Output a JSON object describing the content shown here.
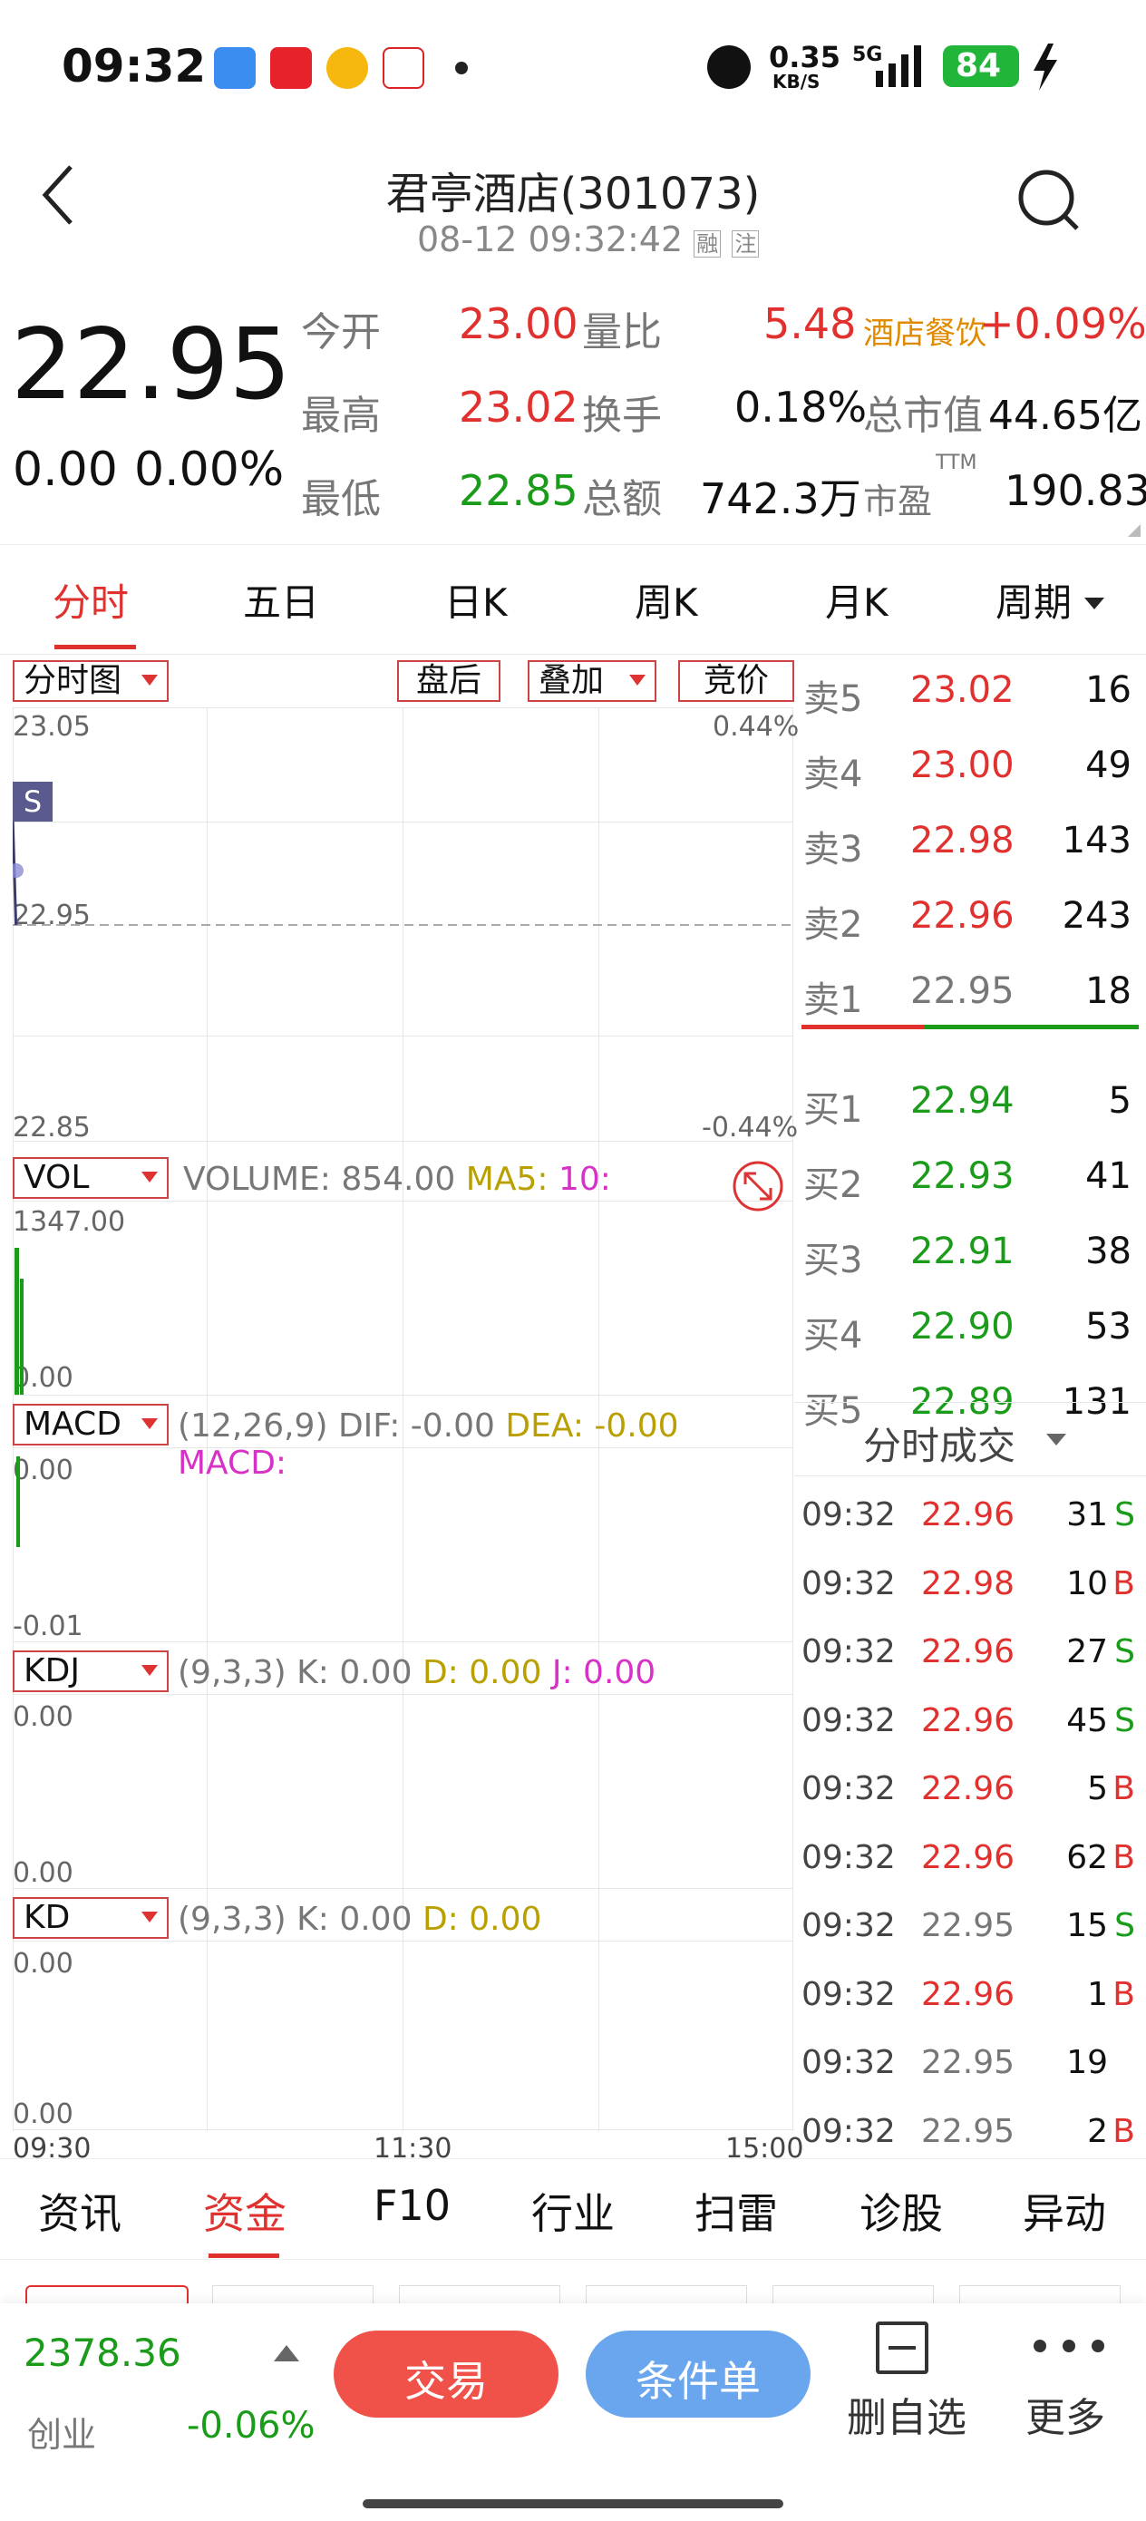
{
  "status_bar": {
    "time": "09:32",
    "net_speed": "0.35",
    "net_unit": "KB/S",
    "signal": "5G",
    "battery": "84"
  },
  "header": {
    "title": "君亭酒店(301073)",
    "subtitle": "08-12 09:32:42",
    "badge1": "融",
    "badge2": "注"
  },
  "quote": {
    "price": "22.95",
    "change": "0.00",
    "change_pct": "0.00%",
    "rows": [
      {
        "l1": "今开",
        "v1": "23.00",
        "l2": "量比",
        "v2": "5.48",
        "l3": "酒店餐饮",
        "v3": "+0.09%"
      },
      {
        "l1": "最高",
        "v1": "23.02",
        "l2": "换手",
        "v2": "0.18%",
        "l3": "总市值",
        "v3": "44.65亿"
      },
      {
        "l1": "最低",
        "v1": "22.85",
        "l2": "总额",
        "v2": "742.3万",
        "l3": "市盈",
        "l3sup": "TTM",
        "v3": "190.83"
      }
    ]
  },
  "tabs": [
    "分时",
    "五日",
    "日K",
    "周K",
    "月K",
    "周期"
  ],
  "chart_controls": {
    "timeshare": "分时图",
    "after": "盘后",
    "overlay": "叠加",
    "auction": "竞价"
  },
  "chart_data": {
    "type": "line",
    "price_high": "23.05",
    "price_low": "22.85",
    "price_mid": "22.95",
    "pct_high": "0.44%",
    "pct_low": "-0.44%",
    "ylim": [
      22.85,
      23.05
    ],
    "x_ticks": [
      "09:30",
      "11:30",
      "15:00"
    ],
    "marker": "S",
    "points": [
      [
        0,
        23.0
      ],
      [
        1,
        22.95
      ]
    ]
  },
  "vol": {
    "sel": "VOL",
    "label": "VOLUME:",
    "value": "854.00",
    "ma5": "MA5:",
    "ma10": "10:",
    "max": "1347.00",
    "min": "0.00"
  },
  "macd": {
    "sel": "MACD",
    "params": "(12,26,9)",
    "dif": "DIF: -0.00",
    "dea": "DEA: -0.00",
    "macd": "MACD:",
    "top": "0.00",
    "bottom": "-0.01"
  },
  "kdj": {
    "sel": "KDJ",
    "params": "(9,3,3)",
    "k": "K: 0.00",
    "d": "D: 0.00",
    "j": "J: 0.00",
    "top": "0.00",
    "bottom": "0.00"
  },
  "kd": {
    "sel": "KD",
    "params": "(9,3,3)",
    "k": "K: 0.00",
    "d": "D: 0.00",
    "top": "0.00",
    "bottom": "0.00"
  },
  "orderbook": [
    {
      "label": "卖5",
      "price": "23.02",
      "vol": "16",
      "color": "red"
    },
    {
      "label": "卖4",
      "price": "23.00",
      "vol": "49",
      "color": "red"
    },
    {
      "label": "卖3",
      "price": "22.98",
      "vol": "143",
      "color": "red"
    },
    {
      "label": "卖2",
      "price": "22.96",
      "vol": "243",
      "color": "red"
    },
    {
      "label": "卖1",
      "price": "22.95",
      "vol": "18",
      "color": "gray"
    },
    {
      "label": "买1",
      "price": "22.94",
      "vol": "5",
      "color": "green"
    },
    {
      "label": "买2",
      "price": "22.93",
      "vol": "41",
      "color": "green"
    },
    {
      "label": "买3",
      "price": "22.91",
      "vol": "38",
      "color": "green"
    },
    {
      "label": "买4",
      "price": "22.90",
      "vol": "53",
      "color": "green"
    },
    {
      "label": "买5",
      "price": "22.89",
      "vol": "131",
      "color": "green"
    }
  ],
  "trades_title": "分时成交",
  "trades": [
    {
      "t": "09:32",
      "p": "22.96",
      "v": "31",
      "s": "S",
      "pc": "red"
    },
    {
      "t": "09:32",
      "p": "22.98",
      "v": "10",
      "s": "B",
      "pc": "red"
    },
    {
      "t": "09:32",
      "p": "22.96",
      "v": "27",
      "s": "S",
      "pc": "red"
    },
    {
      "t": "09:32",
      "p": "22.96",
      "v": "45",
      "s": "S",
      "pc": "red"
    },
    {
      "t": "09:32",
      "p": "22.96",
      "v": "5",
      "s": "B",
      "pc": "red"
    },
    {
      "t": "09:32",
      "p": "22.96",
      "v": "62",
      "s": "B",
      "pc": "red"
    },
    {
      "t": "09:32",
      "p": "22.95",
      "v": "15",
      "s": "S",
      "pc": "gray"
    },
    {
      "t": "09:32",
      "p": "22.96",
      "v": "1",
      "s": "B",
      "pc": "red"
    },
    {
      "t": "09:32",
      "p": "22.95",
      "v": "19",
      "s": "",
      "pc": "gray"
    },
    {
      "t": "09:32",
      "p": "22.95",
      "v": "2",
      "s": "B",
      "pc": "gray"
    }
  ],
  "bottom_tabs": [
    "资讯",
    "资金",
    "F10",
    "行业",
    "扫雷",
    "诊股",
    "异动"
  ],
  "footer": {
    "index_value": "2378.36",
    "index_name": "创业",
    "index_pct": "-0.06%",
    "trade": "交易",
    "condition": "条件单",
    "remove": "删自选",
    "more": "更多"
  },
  "colors": {
    "up": "#e0312f",
    "down": "#1a9c1a",
    "accent": "#e0312f",
    "condition_btn": "#6aa6ee"
  }
}
